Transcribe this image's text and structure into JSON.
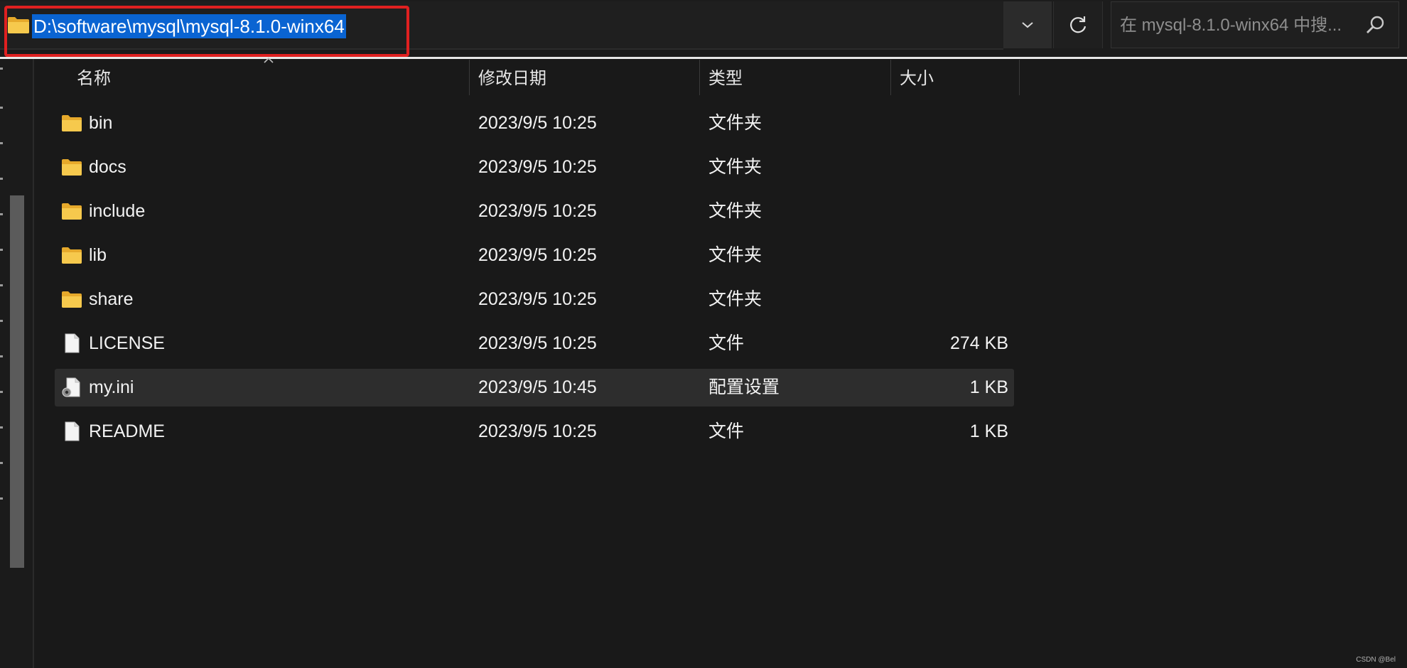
{
  "address_bar": {
    "path": "D:\\software\\mysql\\mysql-8.1.0-winx64"
  },
  "search": {
    "placeholder": "在 mysql-8.1.0-winx64 中搜..."
  },
  "columns": {
    "name": "名称",
    "date": "修改日期",
    "type": "类型",
    "size": "大小"
  },
  "files": [
    {
      "name": "bin",
      "date": "2023/9/5 10:25",
      "type": "文件夹",
      "size": "",
      "icon": "folder-icon"
    },
    {
      "name": "docs",
      "date": "2023/9/5 10:25",
      "type": "文件夹",
      "size": "",
      "icon": "folder-icon"
    },
    {
      "name": "include",
      "date": "2023/9/5 10:25",
      "type": "文件夹",
      "size": "",
      "icon": "folder-icon"
    },
    {
      "name": "lib",
      "date": "2023/9/5 10:25",
      "type": "文件夹",
      "size": "",
      "icon": "folder-icon"
    },
    {
      "name": "share",
      "date": "2023/9/5 10:25",
      "type": "文件夹",
      "size": "",
      "icon": "folder-icon"
    },
    {
      "name": "LICENSE",
      "date": "2023/9/5 10:25",
      "type": "文件",
      "size": "274 KB",
      "icon": "file-icon"
    },
    {
      "name": "my.ini",
      "date": "2023/9/5 10:45",
      "type": "配置设置",
      "size": "1 KB",
      "icon": "config-file-icon"
    },
    {
      "name": "README",
      "date": "2023/9/5 10:25",
      "type": "文件",
      "size": "1 KB",
      "icon": "file-icon"
    }
  ],
  "watermark": "CSDN @Bel",
  "colors": {
    "background": "#191919",
    "selection": "#0a64d2",
    "highlight_box": "#e02020",
    "folder": "#f0c244",
    "selected_row": "#2d2d2d"
  }
}
